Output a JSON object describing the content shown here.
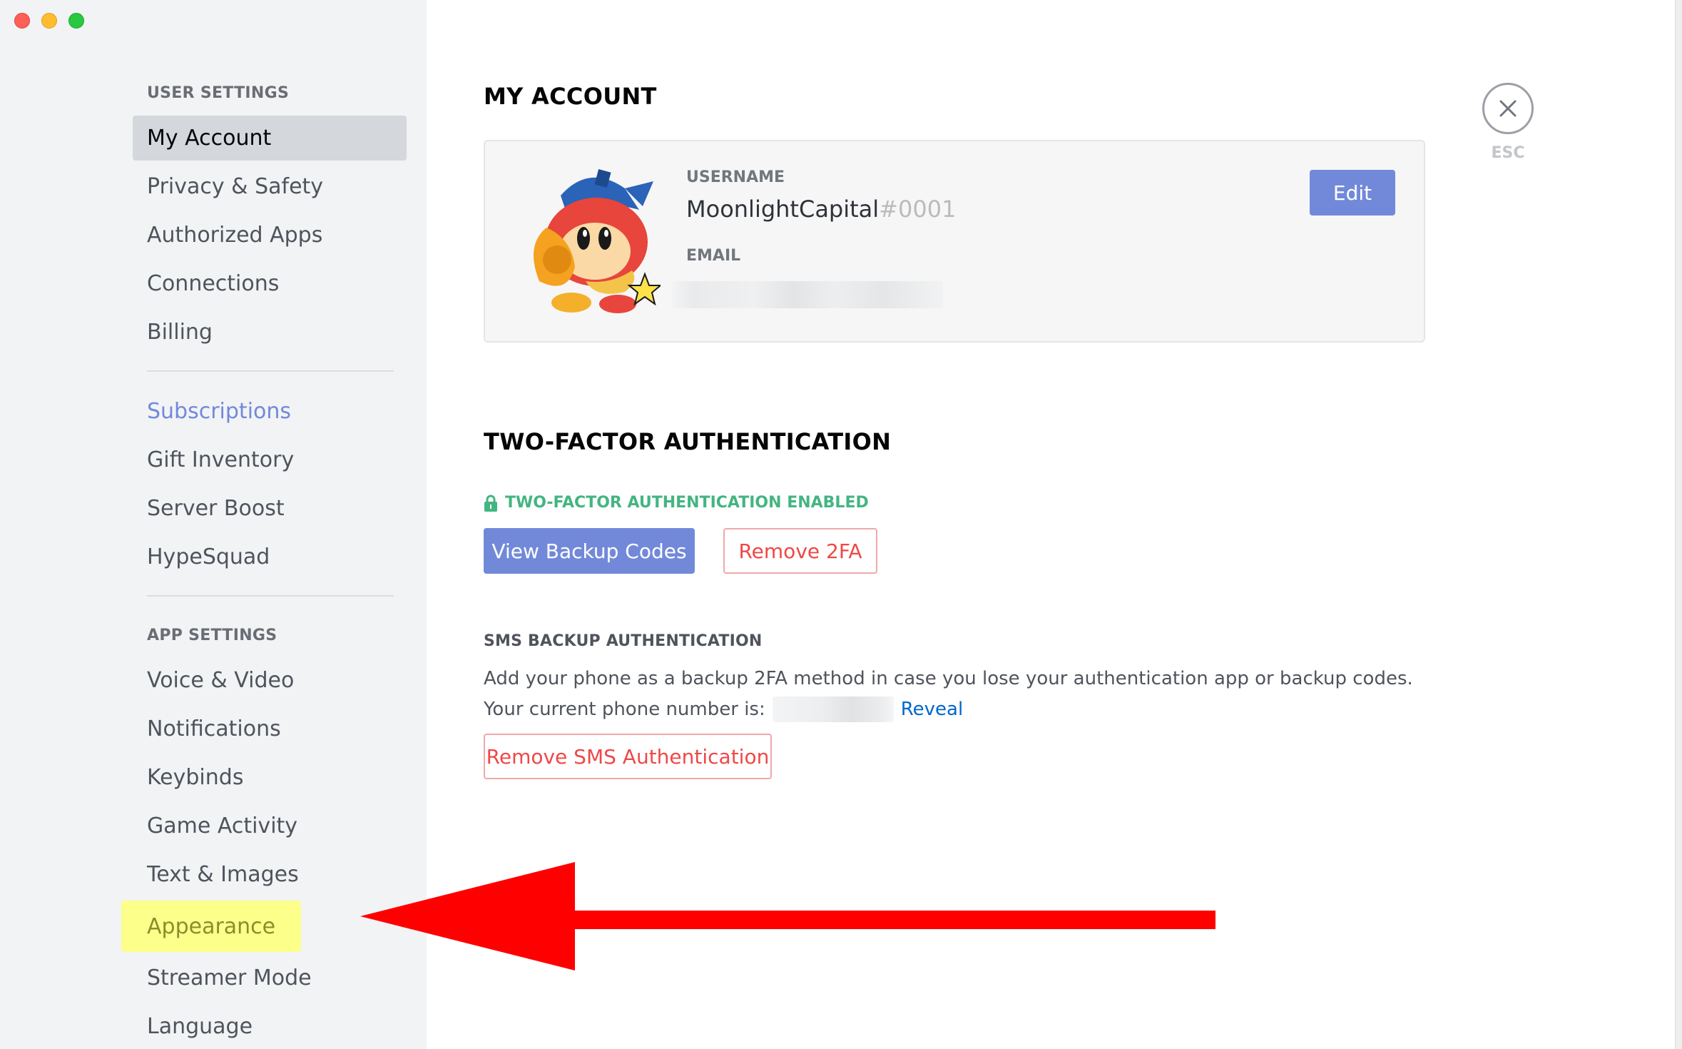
{
  "sidebar": {
    "user_settings_header": "USER SETTINGS",
    "user_items": [
      "My Account",
      "Privacy & Safety",
      "Authorized Apps",
      "Connections",
      "Billing"
    ],
    "billing_items": [
      "Subscriptions",
      "Gift Inventory",
      "Server Boost",
      "HypeSquad"
    ],
    "app_settings_header": "APP SETTINGS",
    "app_items": [
      "Voice & Video",
      "Notifications",
      "Keybinds",
      "Game Activity",
      "Text & Images",
      "Appearance",
      "Streamer Mode",
      "Language"
    ],
    "active_item": "My Account",
    "highlighted_item": "Appearance"
  },
  "account": {
    "title": "MY ACCOUNT",
    "username_label": "USERNAME",
    "username": "MoonlightCapital",
    "discriminator": "#0001",
    "email_label": "EMAIL",
    "edit_label": "Edit"
  },
  "two_factor": {
    "title": "TWO-FACTOR AUTHENTICATION",
    "enabled_text": "TWO-FACTOR AUTHENTICATION ENABLED",
    "view_backup_label": "View Backup Codes",
    "remove_2fa_label": "Remove 2FA"
  },
  "sms": {
    "title": "SMS BACKUP AUTHENTICATION",
    "description": "Add your phone as a backup 2FA method in case you lose your authentication app or backup codes.",
    "phone_prefix": "Your current phone number is:",
    "reveal_label": "Reveal",
    "remove_label": "Remove SMS Authentication"
  },
  "close": {
    "esc_label": "ESC"
  },
  "colors": {
    "brand": "#7289da",
    "danger": "#f04747",
    "success": "#43b581",
    "link": "#0066cc",
    "highlight": "#fcff8a",
    "annotation_arrow": "#ff0000"
  }
}
